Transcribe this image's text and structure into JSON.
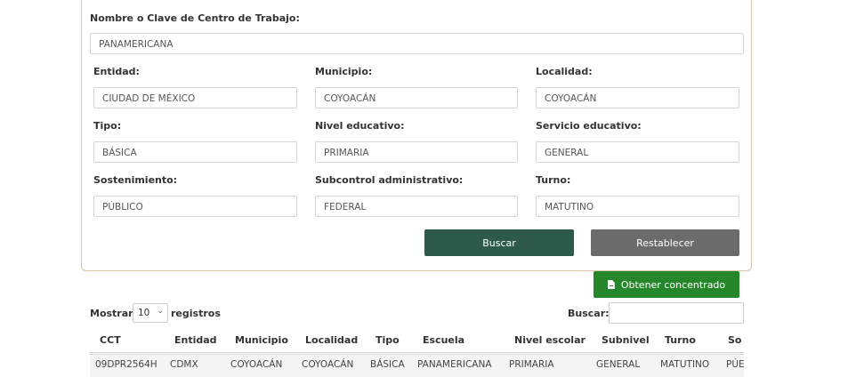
{
  "form": {
    "name_label": "Nombre o Clave de Centro de Trabajo:",
    "name_value": "PANAMERICANA",
    "entidad_label": "Entidad:",
    "entidad_value": "CIUDAD DE MÉXICO",
    "municipio_label": "Municipio:",
    "municipio_value": "COYOACÁN",
    "localidad_label": "Localidad:",
    "localidad_value": "COYOACÁN",
    "tipo_label": "Tipo:",
    "tipo_value": "BÁSICA",
    "nivel_label": "Nivel educativo:",
    "nivel_value": "PRIMARIA",
    "servicio_label": "Servicio educativo:",
    "servicio_value": "GENERAL",
    "sostenimiento_label": "Sostenimiento:",
    "sostenimiento_value": "PÚBLICO",
    "subcontrol_label": "Subcontrol administrativo:",
    "subcontrol_value": "FEDERAL",
    "turno_label": "Turno:",
    "turno_value": "MATUTINO",
    "search_button": "Buscar",
    "reset_button": "Restablecer"
  },
  "export_button": "Obtener concentrado",
  "table_controls": {
    "show_prefix": "Mostrar",
    "page_size": "10",
    "show_suffix": "registros",
    "search_label": "Buscar:"
  },
  "table": {
    "columns": [
      "CCT",
      "Entidad",
      "Municipio",
      "Localidad",
      "Tipo",
      "Escuela",
      "Nivel escolar",
      "Subnivel",
      "Turno",
      "So"
    ],
    "rows": [
      [
        "09DPR2564H",
        "CDMX",
        "COYOACÁN",
        "COYOACÁN",
        "BÁSICA",
        "PANAMERICANA",
        "PRIMARIA",
        "GENERAL",
        "MATUTINO",
        "PÚE"
      ]
    ]
  },
  "colors": {
    "search_button": "#2d5a4a",
    "reset_button": "#6b6b6b",
    "export_button": "#26862a",
    "panel_border": "#d9c7a8"
  },
  "icons": {
    "export": "document-icon",
    "select": "chevron-down-icon"
  }
}
